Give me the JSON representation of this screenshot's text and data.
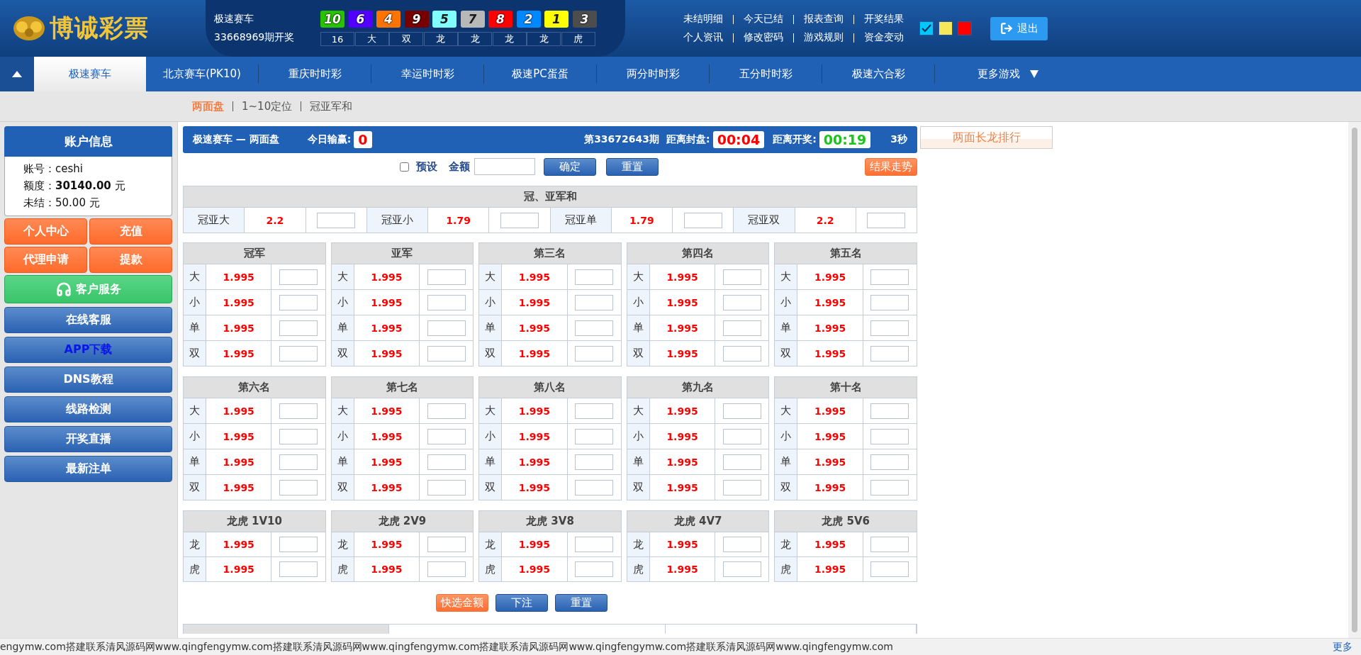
{
  "logo": {
    "text": "博诚彩票"
  },
  "draw": {
    "game": "极速赛车",
    "period": "33668969期开奖",
    "balls": [
      {
        "number": "10",
        "color": "#28c200"
      },
      {
        "number": "6",
        "color": "#5200ff"
      },
      {
        "number": "4",
        "color": "#ff7300"
      },
      {
        "number": "9",
        "color": "#760000"
      },
      {
        "number": "5",
        "color": "#81ffff"
      },
      {
        "number": "7",
        "color": "#b8b8b8"
      },
      {
        "number": "8",
        "color": "#ff0000"
      },
      {
        "number": "2",
        "color": "#0089ff"
      },
      {
        "number": "1",
        "color": "#ffff00"
      },
      {
        "number": "3",
        "color": "#4d4d4d"
      }
    ],
    "stats": [
      "16",
      "大",
      "双",
      "龙",
      "龙",
      "龙",
      "龙",
      "虎"
    ]
  },
  "top_links": [
    [
      "未结明细",
      "今天已结",
      "报表查询",
      "开奖结果"
    ],
    [
      "个人资讯",
      "修改密码",
      "游戏规则",
      "资金变动"
    ]
  ],
  "themes": [
    {
      "color": "#00c8ff",
      "selected": true
    },
    {
      "color": "#f7e85a",
      "selected": false
    },
    {
      "color": "#ff0000",
      "selected": false
    }
  ],
  "logout": "退出",
  "nav": {
    "tabs": [
      {
        "label": "极速赛车",
        "selected": true
      },
      {
        "label": "北京赛车(PK10)",
        "selected": false
      },
      {
        "label": "重庆时时彩",
        "selected": false
      },
      {
        "label": "幸运时时彩",
        "selected": false
      },
      {
        "label": "极速PC蛋蛋",
        "selected": false
      },
      {
        "label": "两分时时彩",
        "selected": false
      },
      {
        "label": "五分时时彩",
        "selected": false
      },
      {
        "label": "极速六合彩",
        "selected": false
      }
    ],
    "more": "更多游戏"
  },
  "subnav": [
    {
      "label": "两面盘",
      "selected": true
    },
    {
      "label": "1~10定位",
      "selected": false
    },
    {
      "label": "冠亚军和",
      "selected": false
    }
  ],
  "account": {
    "title": "账户信息",
    "rows": [
      {
        "label": "账号：",
        "value": "ceshi",
        "unit": ""
      },
      {
        "label": "额度：",
        "value": "30140.00",
        "unit": " 元",
        "bold": true
      },
      {
        "label": "未结：",
        "value": "50.00",
        "unit": " 元",
        "bold": false
      }
    ]
  },
  "side_buttons": [
    {
      "label": "个人中心",
      "kind": "orange"
    },
    {
      "label": "充值",
      "kind": "orange"
    },
    {
      "label": "代理申请",
      "kind": "orange"
    },
    {
      "label": "提款",
      "kind": "orange"
    },
    {
      "label": "客户服务",
      "kind": "service"
    },
    {
      "label": "在线客服",
      "kind": "blue"
    },
    {
      "label": "APP下载",
      "kind": "download"
    },
    {
      "label": "DNS教程",
      "kind": "blue"
    },
    {
      "label": "线路检测",
      "kind": "blue"
    },
    {
      "label": "开奖直播",
      "kind": "blue"
    },
    {
      "label": "最新注单",
      "kind": "blue"
    }
  ],
  "panel": {
    "title": "极速赛车 — 两面盘",
    "profit_label": "今日输赢:",
    "profit": "0",
    "period": "第33672643期",
    "close_label": "距离封盘:",
    "close_time": "00:04",
    "draw_label": "距离开奖:",
    "draw_time": "00:19",
    "refresh": "3秒"
  },
  "controls": {
    "preset": {
      "label": "预设",
      "checked": false
    },
    "amount_label": "金额",
    "confirm": "确定",
    "reset": "重置",
    "trend": "结果走势"
  },
  "sum_group": {
    "title": "冠、亚军和",
    "items": [
      {
        "label": "冠亚大",
        "odds": "2.2"
      },
      {
        "label": "冠亚小",
        "odds": "1.79"
      },
      {
        "label": "冠亚单",
        "odds": "1.79"
      },
      {
        "label": "冠亚双",
        "odds": "2.2"
      }
    ]
  },
  "groups": [
    {
      "title": "冠军",
      "items": [
        {
          "label": "大",
          "odds": "1.995"
        },
        {
          "label": "小",
          "odds": "1.995"
        },
        {
          "label": "单",
          "odds": "1.995"
        },
        {
          "label": "双",
          "odds": "1.995"
        }
      ]
    },
    {
      "title": "亚军",
      "items": [
        {
          "label": "大",
          "odds": "1.995"
        },
        {
          "label": "小",
          "odds": "1.995"
        },
        {
          "label": "单",
          "odds": "1.995"
        },
        {
          "label": "双",
          "odds": "1.995"
        }
      ]
    },
    {
      "title": "第三名",
      "items": [
        {
          "label": "大",
          "odds": "1.995"
        },
        {
          "label": "小",
          "odds": "1.995"
        },
        {
          "label": "单",
          "odds": "1.995"
        },
        {
          "label": "双",
          "odds": "1.995"
        }
      ]
    },
    {
      "title": "第四名",
      "items": [
        {
          "label": "大",
          "odds": "1.995"
        },
        {
          "label": "小",
          "odds": "1.995"
        },
        {
          "label": "单",
          "odds": "1.995"
        },
        {
          "label": "双",
          "odds": "1.995"
        }
      ]
    },
    {
      "title": "第五名",
      "items": [
        {
          "label": "大",
          "odds": "1.995"
        },
        {
          "label": "小",
          "odds": "1.995"
        },
        {
          "label": "单",
          "odds": "1.995"
        },
        {
          "label": "双",
          "odds": "1.995"
        }
      ]
    },
    {
      "title": "第六名",
      "items": [
        {
          "label": "大",
          "odds": "1.995"
        },
        {
          "label": "小",
          "odds": "1.995"
        },
        {
          "label": "单",
          "odds": "1.995"
        },
        {
          "label": "双",
          "odds": "1.995"
        }
      ]
    },
    {
      "title": "第七名",
      "items": [
        {
          "label": "大",
          "odds": "1.995"
        },
        {
          "label": "小",
          "odds": "1.995"
        },
        {
          "label": "单",
          "odds": "1.995"
        },
        {
          "label": "双",
          "odds": "1.995"
        }
      ]
    },
    {
      "title": "第八名",
      "items": [
        {
          "label": "大",
          "odds": "1.995"
        },
        {
          "label": "小",
          "odds": "1.995"
        },
        {
          "label": "单",
          "odds": "1.995"
        },
        {
          "label": "双",
          "odds": "1.995"
        }
      ]
    },
    {
      "title": "第九名",
      "items": [
        {
          "label": "大",
          "odds": "1.995"
        },
        {
          "label": "小",
          "odds": "1.995"
        },
        {
          "label": "单",
          "odds": "1.995"
        },
        {
          "label": "双",
          "odds": "1.995"
        }
      ]
    },
    {
      "title": "第十名",
      "items": [
        {
          "label": "大",
          "odds": "1.995"
        },
        {
          "label": "小",
          "odds": "1.995"
        },
        {
          "label": "单",
          "odds": "1.995"
        },
        {
          "label": "双",
          "odds": "1.995"
        }
      ]
    },
    {
      "title": "龙虎 1V10",
      "items": [
        {
          "label": "龙",
          "odds": "1.995"
        },
        {
          "label": "虎",
          "odds": "1.995"
        }
      ]
    },
    {
      "title": "龙虎 2V9",
      "items": [
        {
          "label": "龙",
          "odds": "1.995"
        },
        {
          "label": "虎",
          "odds": "1.995"
        }
      ]
    },
    {
      "title": "龙虎 3V8",
      "items": [
        {
          "label": "龙",
          "odds": "1.995"
        },
        {
          "label": "虎",
          "odds": "1.995"
        }
      ]
    },
    {
      "title": "龙虎 4V7",
      "items": [
        {
          "label": "龙",
          "odds": "1.995"
        },
        {
          "label": "虎",
          "odds": "1.995"
        }
      ]
    },
    {
      "title": "龙虎 5V6",
      "items": [
        {
          "label": "龙",
          "odds": "1.995"
        },
        {
          "label": "虎",
          "odds": "1.995"
        }
      ]
    }
  ],
  "actions": [
    {
      "label": "快选金额",
      "kind": "orange"
    },
    {
      "label": "下注",
      "kind": "blue"
    },
    {
      "label": "重置",
      "kind": "blue"
    }
  ],
  "ranking": {
    "title": "两面长龙排行"
  },
  "notice": {
    "text": "engymw.com搭建联系清风源码网www.qingfengymw.com搭建联系清风源码网www.qingfengymw.com搭建联系清风源码网www.qingfengymw.com搭建联系清风源码网www.qingfengymw.com",
    "more": "更多"
  }
}
